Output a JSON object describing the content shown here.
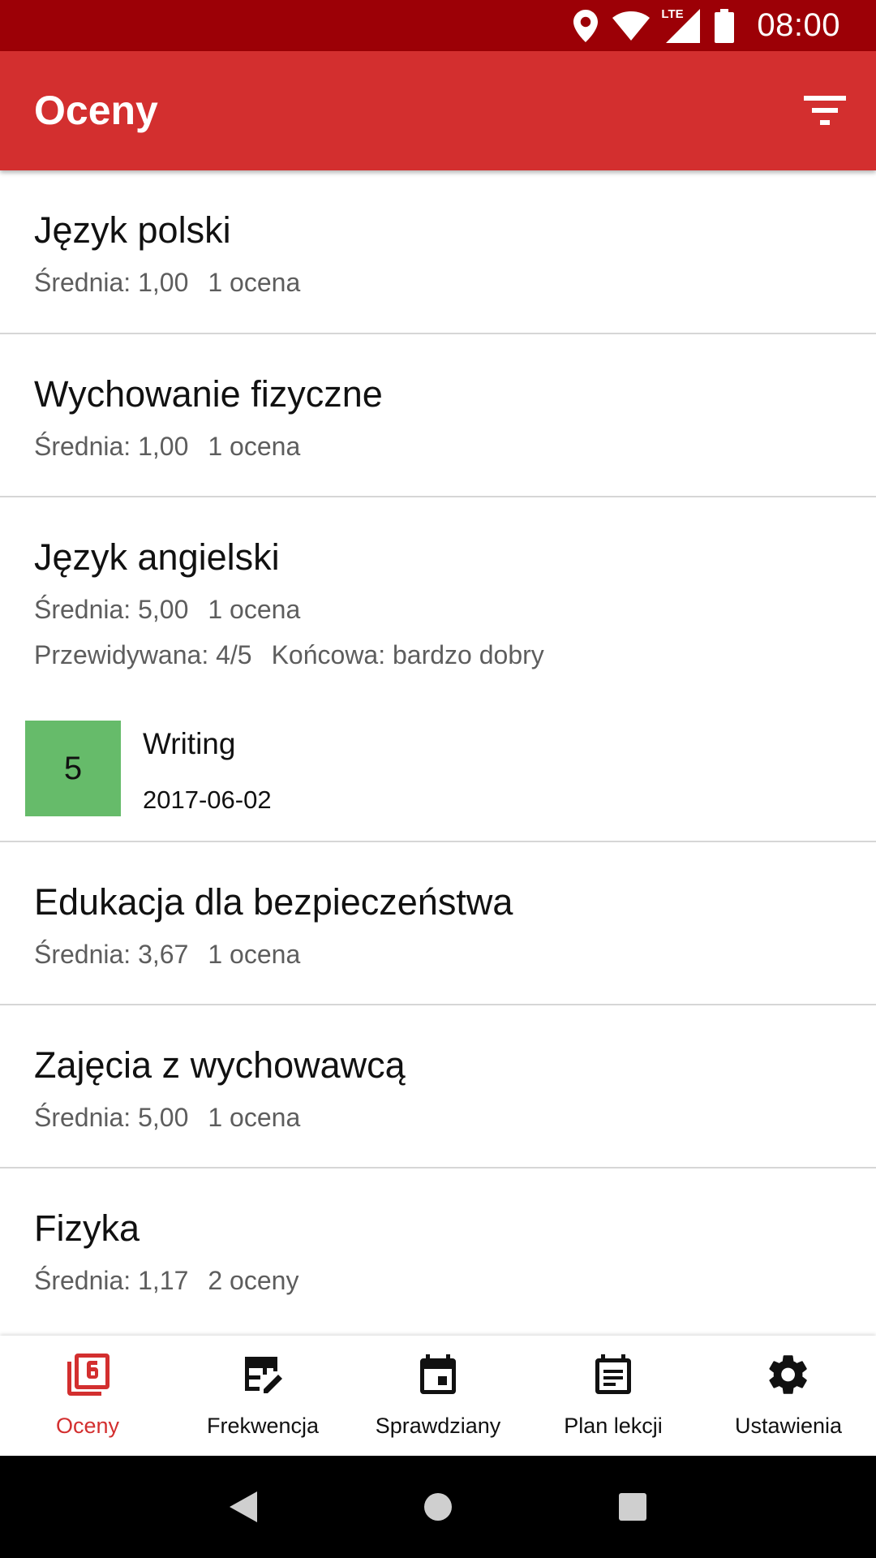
{
  "status_bar": {
    "time": "08:00",
    "network_label": "LTE",
    "icons": [
      "location-icon",
      "wifi-icon",
      "lte-signal-icon",
      "battery-icon"
    ]
  },
  "app_bar": {
    "title": "Oceny",
    "filter_icon": "filter-icon"
  },
  "subjects": [
    {
      "name": "Język polski",
      "average": "Średnia: 1,00",
      "count": "1 ocena"
    },
    {
      "name": "Wychowanie fizyczne",
      "average": "Średnia: 1,00",
      "count": "1 ocena"
    },
    {
      "name": "Język angielski",
      "average": "Średnia: 5,00",
      "count": "1 ocena",
      "predicted": "Przewidywana: 4/5",
      "final": "Końcowa: bardzo dobry",
      "grades": [
        {
          "value": "5",
          "description": "Writing",
          "date": "2017-06-02",
          "color": "#66bb6a"
        }
      ]
    },
    {
      "name": "Edukacja dla bezpieczeństwa",
      "average": "Średnia: 3,67",
      "count": "1 ocena"
    },
    {
      "name": "Zajęcia z wychowawcą",
      "average": "Średnia: 5,00",
      "count": "1 ocena"
    },
    {
      "name": "Fizyka",
      "average": "Średnia: 1,17",
      "count": "2 oceny"
    }
  ],
  "bottom_nav": {
    "items": [
      {
        "label": "Oceny",
        "icon": "grades-icon",
        "active": true
      },
      {
        "label": "Frekwencja",
        "icon": "attendance-icon",
        "active": false
      },
      {
        "label": "Sprawdziany",
        "icon": "calendar-icon",
        "active": false
      },
      {
        "label": "Plan lekcji",
        "icon": "timetable-icon",
        "active": false
      },
      {
        "label": "Ustawienia",
        "icon": "settings-icon",
        "active": false
      }
    ]
  },
  "system_nav": {
    "icons": [
      "back-icon",
      "home-icon",
      "recents-icon"
    ]
  },
  "colors": {
    "status_bar": "#9c0006",
    "app_bar": "#d32f2f",
    "accent": "#d32f2f",
    "grade_5": "#66bb6a"
  }
}
